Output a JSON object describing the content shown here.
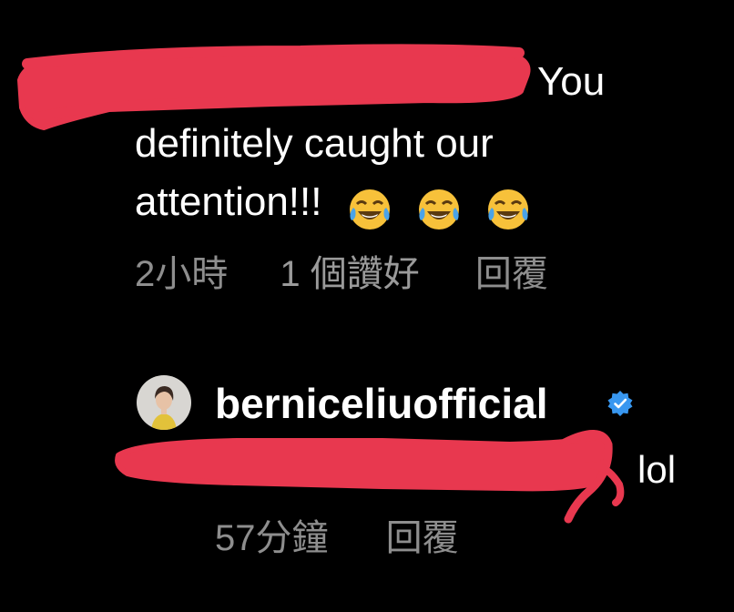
{
  "comment_1": {
    "text_line1": "You",
    "text_line2": "definitely caught our",
    "text_line3": "attention!!!",
    "emojis": [
      "face-with-tears-of-joy",
      "face-with-tears-of-joy",
      "face-with-tears-of-joy"
    ],
    "time": "2小時",
    "likes": "1 個讚好",
    "reply_label": "回覆"
  },
  "comment_2": {
    "username": "berniceliuofficial",
    "verified": true,
    "text_visible": "lol",
    "time": "57分鐘",
    "reply_label": "回覆"
  },
  "colors": {
    "background": "#000000",
    "text": "#ffffff",
    "meta_text": "#8e8e8e",
    "verified_badge": "#3897f0",
    "redaction_marker": "#e8384f"
  }
}
